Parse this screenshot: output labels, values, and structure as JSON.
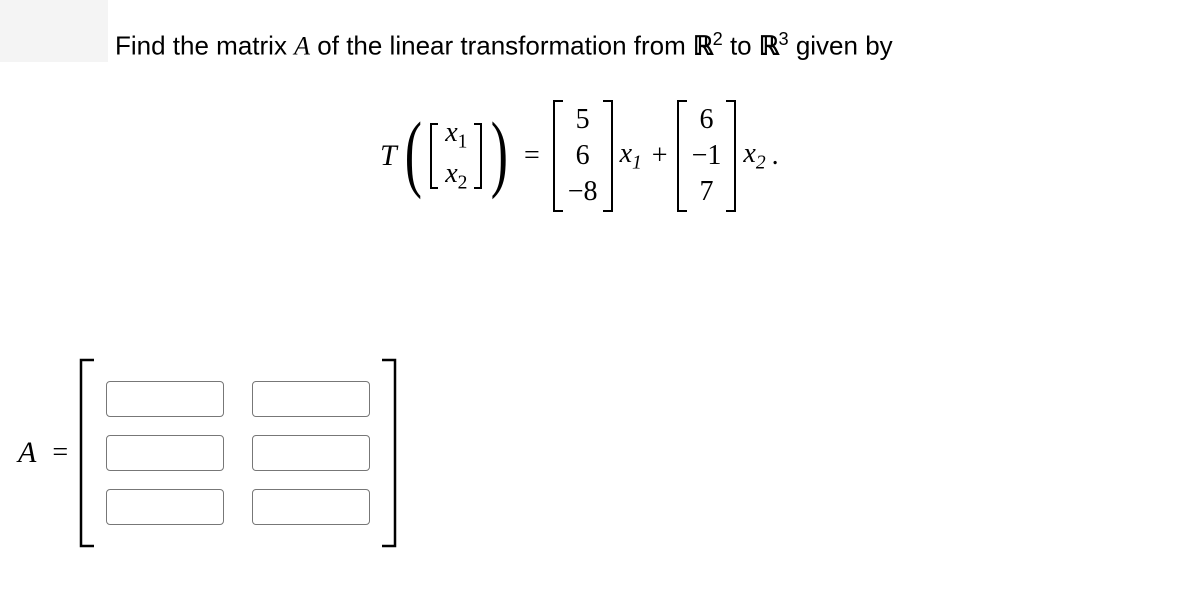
{
  "prompt": {
    "text1": "Find the matrix ",
    "A": "A",
    "text2": " of the linear transformation from ",
    "R2": "ℝ",
    "exp2": "2",
    "to": " to ",
    "R3": "ℝ",
    "exp3": "3",
    "given": " given by"
  },
  "equation": {
    "T": "T",
    "lparen": "(",
    "vec_in": {
      "r1": "x",
      "sub1": "1",
      "r2": "x",
      "sub2": "2"
    },
    "rparen": ")",
    "eq": "=",
    "col1": {
      "r1": "5",
      "r2": "6",
      "r3": "−8"
    },
    "x1": "x",
    "x1sub": "1",
    "plus": "+",
    "col2": {
      "r1": "6",
      "r2": "−1",
      "r3": "7"
    },
    "x2": "x",
    "x2sub": "2",
    "period": "."
  },
  "answer": {
    "A": "A",
    "eq": "=",
    "inputs": [
      [
        "",
        ""
      ],
      [
        "",
        ""
      ],
      [
        "",
        ""
      ]
    ]
  }
}
